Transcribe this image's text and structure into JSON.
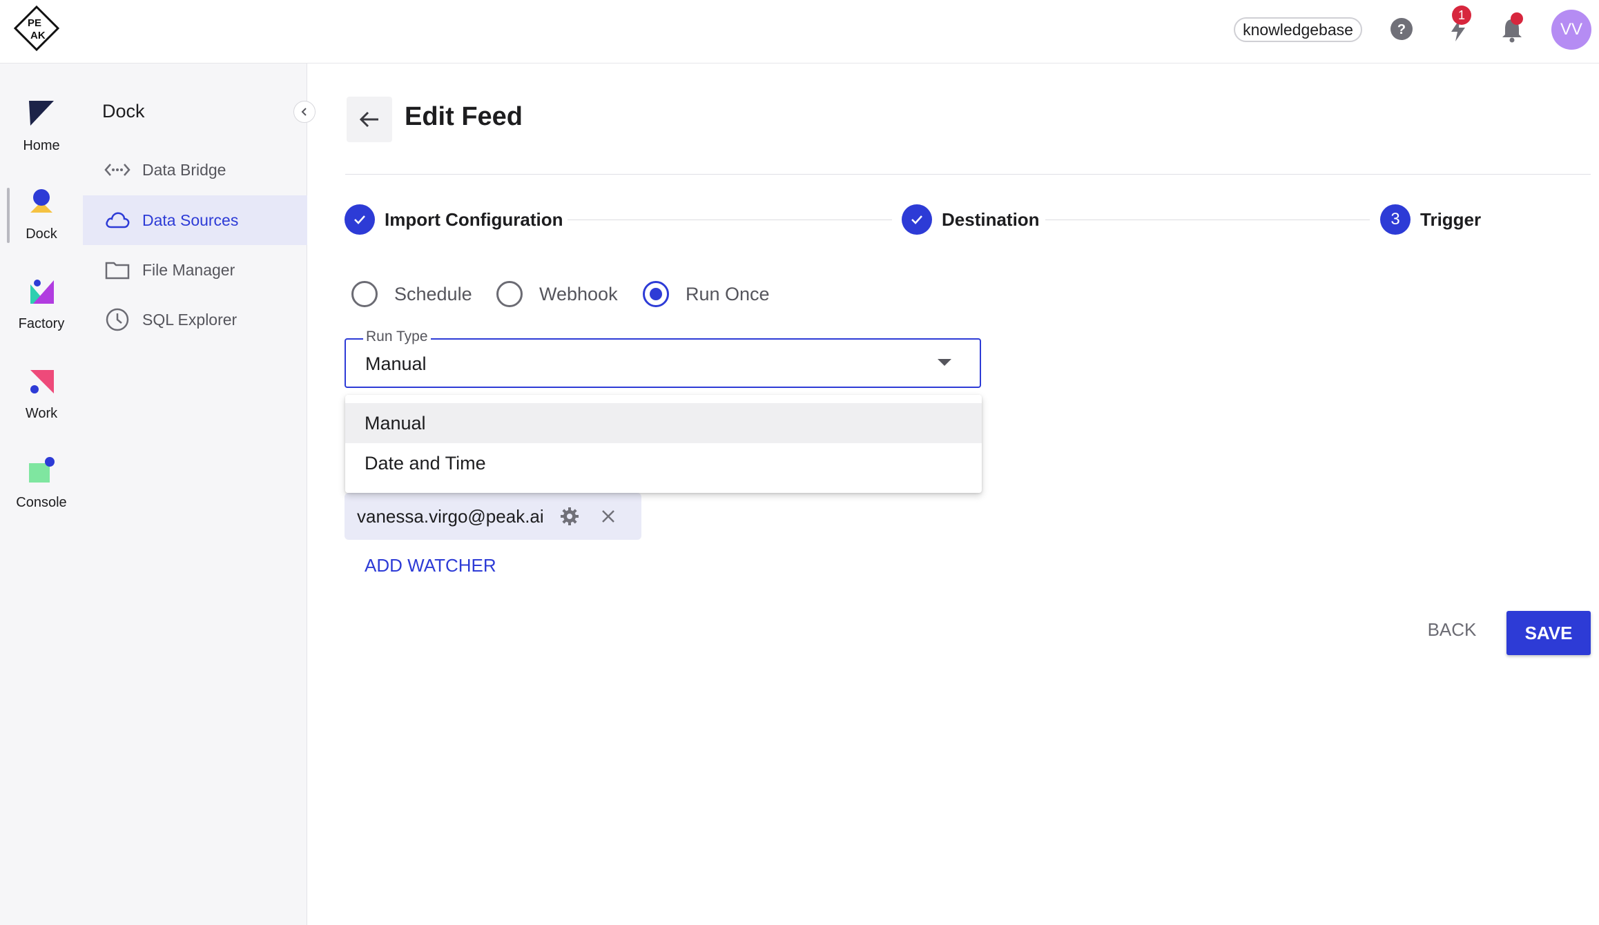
{
  "header": {
    "logo_name": "peak-logo",
    "workspace_chip": "knowledgebase",
    "notification_badge": "1",
    "avatar_initials": "VV",
    "accent_color": "#2d3bd6"
  },
  "rail": {
    "items": [
      {
        "label": "Home",
        "icon": "home-icon"
      },
      {
        "label": "Dock",
        "icon": "dock-icon"
      },
      {
        "label": "Factory",
        "icon": "factory-icon"
      },
      {
        "label": "Work",
        "icon": "work-icon"
      },
      {
        "label": "Console",
        "icon": "console-icon"
      }
    ]
  },
  "dock": {
    "title": "Dock",
    "items": [
      {
        "label": "Data Bridge",
        "icon": "data-bridge-icon"
      },
      {
        "label": "Data Sources",
        "icon": "cloud-icon",
        "active": true
      },
      {
        "label": "File Manager",
        "icon": "folder-icon"
      },
      {
        "label": "SQL Explorer",
        "icon": "clock-icon"
      }
    ]
  },
  "main": {
    "title": "Edit Feed",
    "steps": [
      {
        "label": "Import Configuration",
        "state": "done"
      },
      {
        "label": "Destination",
        "state": "done"
      },
      {
        "label": "Trigger",
        "number": "3",
        "state": "active"
      }
    ],
    "trigger_options": [
      {
        "label": "Schedule",
        "checked": false
      },
      {
        "label": "Webhook",
        "checked": false
      },
      {
        "label": "Run Once",
        "checked": true
      }
    ],
    "run_type": {
      "label": "Run Type",
      "value": "Manual",
      "options": [
        "Manual",
        "Date and Time"
      ]
    },
    "watcher": {
      "email": "vanessa.virgo@peak.ai"
    },
    "add_watcher_label": "ADD WATCHER",
    "back_label": "BACK",
    "save_label": "SAVE"
  }
}
